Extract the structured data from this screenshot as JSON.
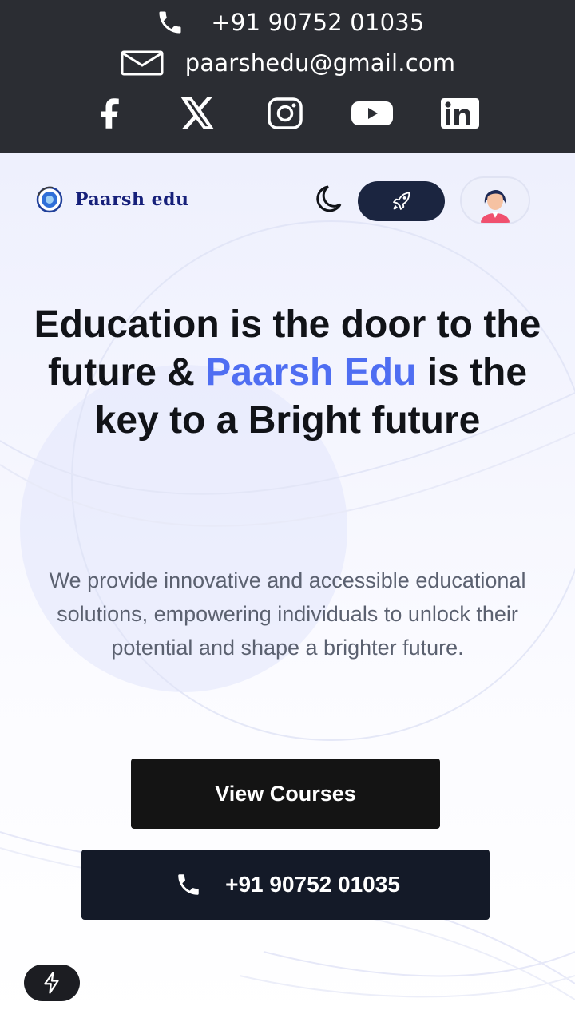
{
  "topbar": {
    "phone": "+91 90752 01035",
    "email": "paarshedu@gmail.com",
    "phone_icon": "phone-icon",
    "email_icon": "mail-icon",
    "social": [
      "facebook-icon",
      "x-twitter-icon",
      "instagram-icon",
      "youtube-icon",
      "linkedin-icon"
    ]
  },
  "navbar": {
    "logo_text": "Paarsh edu",
    "theme_icon": "moon-icon",
    "cta_icon": "rocket-icon",
    "avatar_icon": "user-avatar-icon"
  },
  "hero": {
    "headline_part1": "Education is the door to the future & ",
    "headline_accent": "Paarsh Edu",
    "headline_part2": " is the key to a Bright future",
    "subtext": "We provide innovative and accessible educational solutions, empowering individuals to unlock their potential and shape a brighter future.",
    "view_courses_label": "View Courses",
    "phone_button_label": "+91 90752 01035"
  },
  "fab_icon": "lightning-icon",
  "colors": {
    "topbar_bg": "#2b2d33",
    "accent": "#4f6ef2",
    "logo_navy": "#16207a",
    "button_dark": "#141414",
    "button_navy": "#141a28"
  }
}
